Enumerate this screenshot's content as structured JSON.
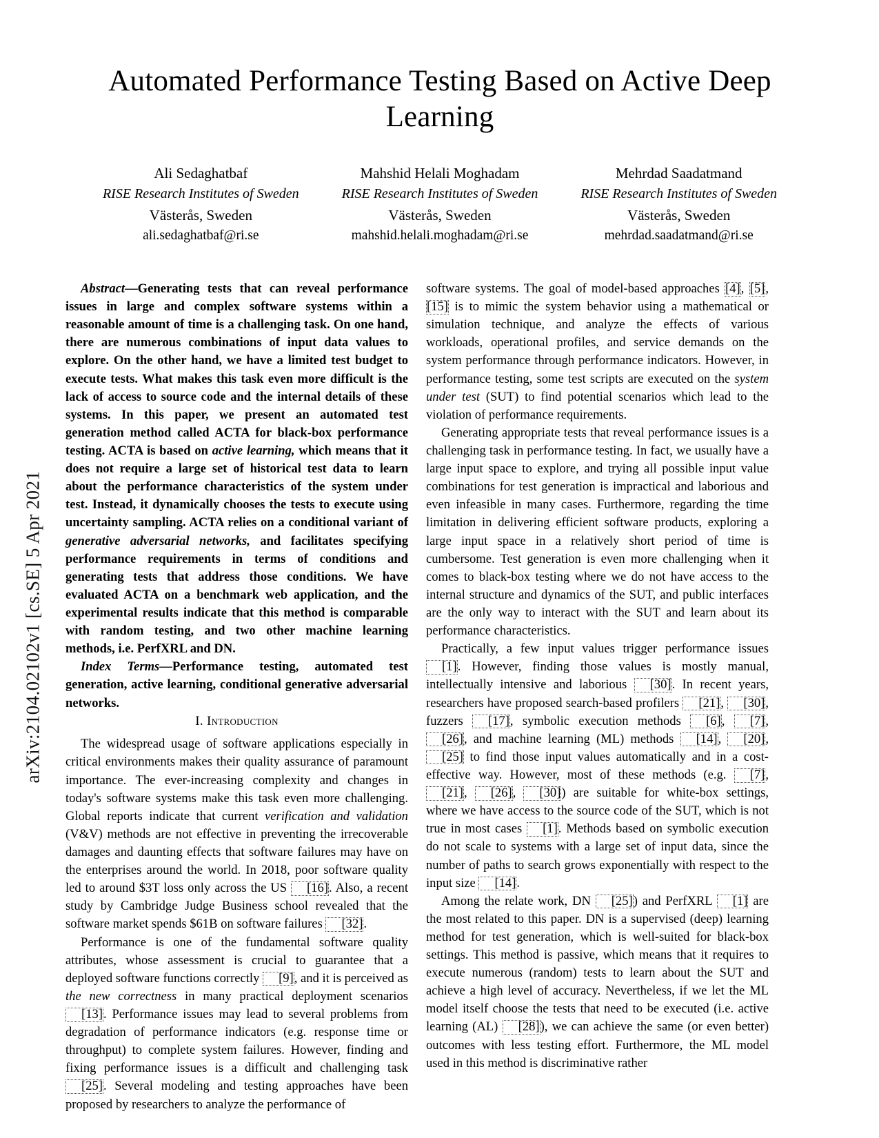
{
  "arxiv_stamp": "arXiv:2104.02102v1  [cs.SE]  5 Apr 2021",
  "title": "Automated Performance Testing Based on Active Deep Learning",
  "authors": [
    {
      "name": "Ali Sedaghatbaf",
      "affiliation": "RISE Research Institutes of Sweden",
      "location": "Västerås, Sweden",
      "email": "ali.sedaghatbaf@ri.se"
    },
    {
      "name": "Mahshid Helali Moghadam",
      "affiliation": "RISE Research Institutes of Sweden",
      "location": "Västerås, Sweden",
      "email": "mahshid.helali.moghadam@ri.se"
    },
    {
      "name": "Mehrdad Saadatmand",
      "affiliation": "RISE Research Institutes of Sweden",
      "location": "Västerås, Sweden",
      "email": "mehrdad.saadatmand@ri.se"
    }
  ],
  "abstract": {
    "label": "Abstract",
    "dash": "—",
    "text_1": "Generating tests that can reveal performance issues in large and complex software systems within a reasonable amount of time is a challenging task. On one hand, there are numerous combinations of input data values to explore. On the other hand, we have a limited test budget to execute tests. What makes this task even more difficult is the lack of access to source code and the internal details of these systems. In this paper, we present an automated test generation method called ACTA for black-box performance testing. ACTA is based on ",
    "em_1": "active learning,",
    "text_2": " which means that it does not require a large set of historical test data to learn about the performance characteristics of the system under test. Instead, it dynamically chooses the tests to execute using uncertainty sampling. ACTA relies on a conditional variant of ",
    "em_2": "generative adversarial networks,",
    "text_3": " and facilitates specifying performance requirements in terms of conditions and generating tests that address those conditions. We have evaluated ACTA on a benchmark web application, and the experimental results indicate that this method is comparable with random testing, and two other machine learning methods, i.e. PerfXRL and DN."
  },
  "index_terms": {
    "label": "Index Terms",
    "dash": "—",
    "text": "Performance testing, automated test generation, active learning, conditional generative adversarial networks."
  },
  "sections": {
    "introduction_heading": "I.  Introduction"
  },
  "left_column": {
    "p1_a": "The widespread usage of software applications especially in critical environments makes their quality assurance of paramount importance. The ever-increasing complexity and changes in today's software systems make this task even more challenging. Global reports indicate that current ",
    "p1_em": "verification and validation",
    "p1_b": " (V&V) methods are not effective in preventing the irrecoverable damages and daunting effects that software failures may have on the enterprises around the world. In 2018, poor software quality led to around $3T loss only across the US ",
    "p1_cite1": "[16]",
    "p1_c": ". Also, a recent study by Cambridge Judge Business school revealed that the software market spends $61B on software failures ",
    "p1_cite2": "[32]",
    "p1_d": ".",
    "p2_a": "Performance is one of the fundamental software quality attributes, whose assessment is crucial to guarantee that a deployed software functions correctly ",
    "p2_cite1": "[9]",
    "p2_b": ", and it is perceived as ",
    "p2_em": "the new correctness",
    "p2_c": " in many practical deployment scenarios ",
    "p2_cite2": "[13]",
    "p2_d": ". Performance issues may lead to several problems from degradation of performance indicators (e.g. response time or throughput) to complete system failures. However, finding and fixing performance issues is a difficult and challenging task ",
    "p2_cite3": "[25]",
    "p2_e": ". Several modeling and testing approaches have been proposed by researchers to analyze the performance of"
  },
  "right_column": {
    "p1_a": "software systems. The goal of model-based approaches ",
    "p1_cite1": "[4]",
    "p1_b": ", ",
    "p1_cite2": "[5]",
    "p1_c": ", ",
    "p1_cite3": "[15]",
    "p1_d": " is to mimic the system behavior using a mathematical or simulation technique, and analyze the effects of various workloads, operational profiles, and service demands on the system performance through performance indicators. However, in performance testing, some test scripts are executed on the ",
    "p1_em": "system under test",
    "p1_e": " (SUT) to find potential scenarios which lead to the violation of performance requirements.",
    "p2": "Generating appropriate tests that reveal performance issues is a challenging task in performance testing. In fact, we usually have a large input space to explore, and trying all possible input value combinations for test generation is impractical and laborious and even infeasible in many cases. Furthermore, regarding the time limitation in delivering efficient software products, exploring a large input space in a relatively short period of time is cumbersome. Test generation is even more challenging when it comes to black-box testing where we do not have access to the internal structure and dynamics of the SUT, and public interfaces are the only way to interact with the SUT and learn about its performance characteristics.",
    "p3_a": "Practically, a few input values trigger performance issues ",
    "p3_cite1": "[1]",
    "p3_b": ". However, finding those values is mostly manual, intellectually intensive and laborious ",
    "p3_cite2": "[30]",
    "p3_c": ". In recent years, researchers have proposed search-based profilers ",
    "p3_cite3": "[21]",
    "p3_d": ", ",
    "p3_cite4": "[30]",
    "p3_e": ", fuzzers ",
    "p3_cite5": "[17]",
    "p3_f": ", symbolic execution methods ",
    "p3_cite6": "[6]",
    "p3_g": ", ",
    "p3_cite7": "[7]",
    "p3_h": ", ",
    "p3_cite8": "[26]",
    "p3_i": ", and machine learning (ML) methods ",
    "p3_cite9": "[14]",
    "p3_j": ", ",
    "p3_cite10": "[20]",
    "p3_k": ", ",
    "p3_cite11": "[25]",
    "p3_l": " to find those input values automatically and in a cost-effective way. However, most of these methods (e.g. ",
    "p3_cite12": "[7]",
    "p3_m": ", ",
    "p3_cite13": "[21]",
    "p3_n": ", ",
    "p3_cite14": "[26]",
    "p3_o": ", ",
    "p3_cite15": "[30]",
    "p3_p": ") are suitable for white-box settings, where we have access to the source code of the SUT, which is not true in most cases ",
    "p3_cite16": "[1]",
    "p3_q": ". Methods based on symbolic execution do not scale to systems with a large set of input data, since the number of paths to search grows exponentially with respect to the input size ",
    "p3_cite17": "[14]",
    "p3_r": ".",
    "p4_a": "Among the relate work, DN ",
    "p4_cite1": "[25]",
    "p4_b": ") and PerfXRL ",
    "p4_cite2": "[1]",
    "p4_c": " are the most related to this paper. DN is a supervised (deep) learning method for test generation, which is well-suited for black-box settings. This method is passive, which means that it requires to execute numerous (random) tests to learn about the SUT and achieve a high level of accuracy. Nevertheless, if we let the ML model itself choose the tests that need to be executed (i.e. active learning (AL) ",
    "p4_cite3": "[28]",
    "p4_d": "), we can achieve the same (or even better) outcomes with less testing effort. Furthermore, the ML model used in this method is discriminative rather"
  }
}
